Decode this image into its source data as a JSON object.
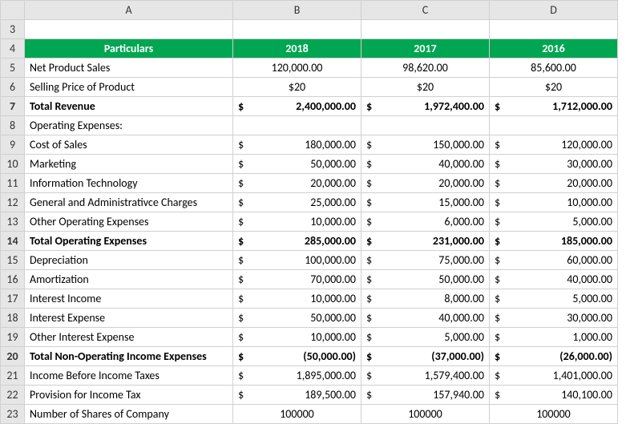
{
  "colHeaders": [
    "A",
    "B",
    "C",
    "D"
  ],
  "rowHeaders": [
    "3",
    "4",
    "5",
    "6",
    "7",
    "8",
    "9",
    "10",
    "11",
    "12",
    "13",
    "14",
    "15",
    "16",
    "17",
    "18",
    "19",
    "20",
    "21",
    "22",
    "23"
  ],
  "header": {
    "a": "Particulars",
    "b": "2018",
    "c": "2017",
    "d": "2016"
  },
  "rows": [
    {
      "a": "Net Product Sales",
      "b": "120,000.00",
      "c": "98,620.00",
      "d": "85,600.00",
      "cur": false,
      "bold": false,
      "center": true
    },
    {
      "a": "Selling Price of Product",
      "b": "$20",
      "c": "$20",
      "d": "$20",
      "cur": false,
      "bold": false,
      "center": true
    },
    {
      "a": "Total Revenue",
      "b": "2,400,000.00",
      "c": "1,972,400.00",
      "d": "1,712,000.00",
      "cur": true,
      "bold": true
    },
    {
      "a": "Operating Expenses:",
      "b": "",
      "c": "",
      "d": "",
      "cur": false,
      "bold": false
    },
    {
      "a": "Cost of Sales",
      "b": "180,000.00",
      "c": "150,000.00",
      "d": "120,000.00",
      "cur": true,
      "bold": false
    },
    {
      "a": "Marketing",
      "b": "50,000.00",
      "c": "40,000.00",
      "d": "30,000.00",
      "cur": true,
      "bold": false
    },
    {
      "a": "Information Technology",
      "b": "20,000.00",
      "c": "20,000.00",
      "d": "20,000.00",
      "cur": true,
      "bold": false
    },
    {
      "a": "General and Administrativce Charges",
      "b": "25,000.00",
      "c": "15,000.00",
      "d": "10,000.00",
      "cur": true,
      "bold": false
    },
    {
      "a": "Other Operating Expenses",
      "b": "10,000.00",
      "c": "6,000.00",
      "d": "5,000.00",
      "cur": true,
      "bold": false
    },
    {
      "a": "Total Operating Expenses",
      "b": "285,000.00",
      "c": "231,000.00",
      "d": "185,000.00",
      "cur": true,
      "bold": true
    },
    {
      "a": "Depreciation",
      "b": "100,000.00",
      "c": "75,000.00",
      "d": "60,000.00",
      "cur": true,
      "bold": false
    },
    {
      "a": "Amortization",
      "b": "70,000.00",
      "c": "50,000.00",
      "d": "40,000.00",
      "cur": true,
      "bold": false
    },
    {
      "a": "Interest Income",
      "b": "10,000.00",
      "c": "8,000.00",
      "d": "5,000.00",
      "cur": true,
      "bold": false
    },
    {
      "a": "Interest Expense",
      "b": "50,000.00",
      "c": "40,000.00",
      "d": "30,000.00",
      "cur": true,
      "bold": false
    },
    {
      "a": "Other Interest Expense",
      "b": "10,000.00",
      "c": "5,000.00",
      "d": "1,000.00",
      "cur": true,
      "bold": false
    },
    {
      "a": "Total Non-Operating Income Expenses",
      "b": "(50,000.00)",
      "c": "(37,000.00)",
      "d": "(26,000.00)",
      "cur": true,
      "bold": true
    },
    {
      "a": "Income Before Income Taxes",
      "b": "1,895,000.00",
      "c": "1,579,400.00",
      "d": "1,401,000.00",
      "cur": true,
      "bold": false
    },
    {
      "a": "Provision for Income Tax",
      "b": "189,500.00",
      "c": "157,940.00",
      "d": "140,100.00",
      "cur": true,
      "bold": false
    },
    {
      "a": "Number of Shares of Company",
      "b": "100000",
      "c": "100000",
      "d": "100000",
      "cur": false,
      "bold": false,
      "center": true
    }
  ],
  "currencySymbol": "$"
}
